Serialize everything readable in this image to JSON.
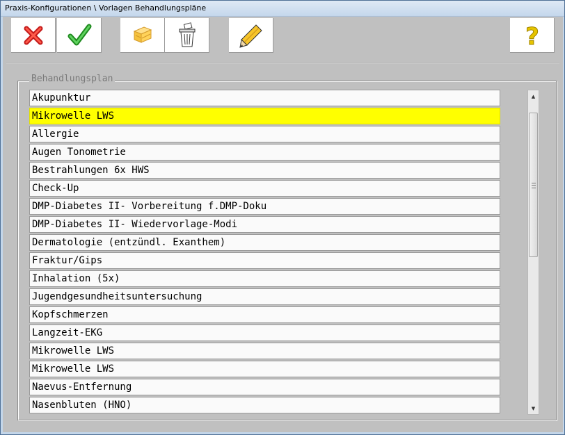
{
  "window": {
    "title": "Praxis-Konfigurationen \\ Vorlagen Behandlungspläne"
  },
  "toolbar": {
    "buttons": [
      {
        "name": "cancel-button",
        "icon": "red-x-icon"
      },
      {
        "name": "ok-button",
        "icon": "green-check-icon"
      },
      {
        "name": "copy-button",
        "icon": "stacked-boxes-icon"
      },
      {
        "name": "delete-button",
        "icon": "trash-can-icon"
      },
      {
        "name": "edit-button",
        "icon": "pencil-icon"
      },
      {
        "name": "help-button",
        "icon": "question-mark-icon"
      }
    ]
  },
  "group": {
    "legend": "Behandlungsplan"
  },
  "list": {
    "selected_index": 1,
    "items": [
      "Akupunktur",
      "Mikrowelle LWS",
      "Allergie",
      "Augen Tonometrie",
      "Bestrahlungen 6x HWS",
      "Check-Up",
      "DMP-Diabetes II- Vorbereitung f.DMP-Doku",
      "DMP-Diabetes II- Wiedervorlage-Modi",
      "Dermatologie (entzündl. Exanthem)",
      "Fraktur/Gips",
      "Inhalation (5x)",
      "Jugendgesundheitsuntersuchung",
      "Kopfschmerzen",
      "Langzeit-EKG",
      "Mikrowelle LWS",
      "Mikrowelle LWS",
      "Naevus-Entfernung",
      "Nasenbluten (HNO)"
    ]
  },
  "colors": {
    "selection": "#ffff00",
    "client_bg": "#c0c0c0",
    "titlebar": "#c4d7ec"
  },
  "scrollbar": {
    "up_glyph": "▲",
    "down_glyph": "▼"
  }
}
